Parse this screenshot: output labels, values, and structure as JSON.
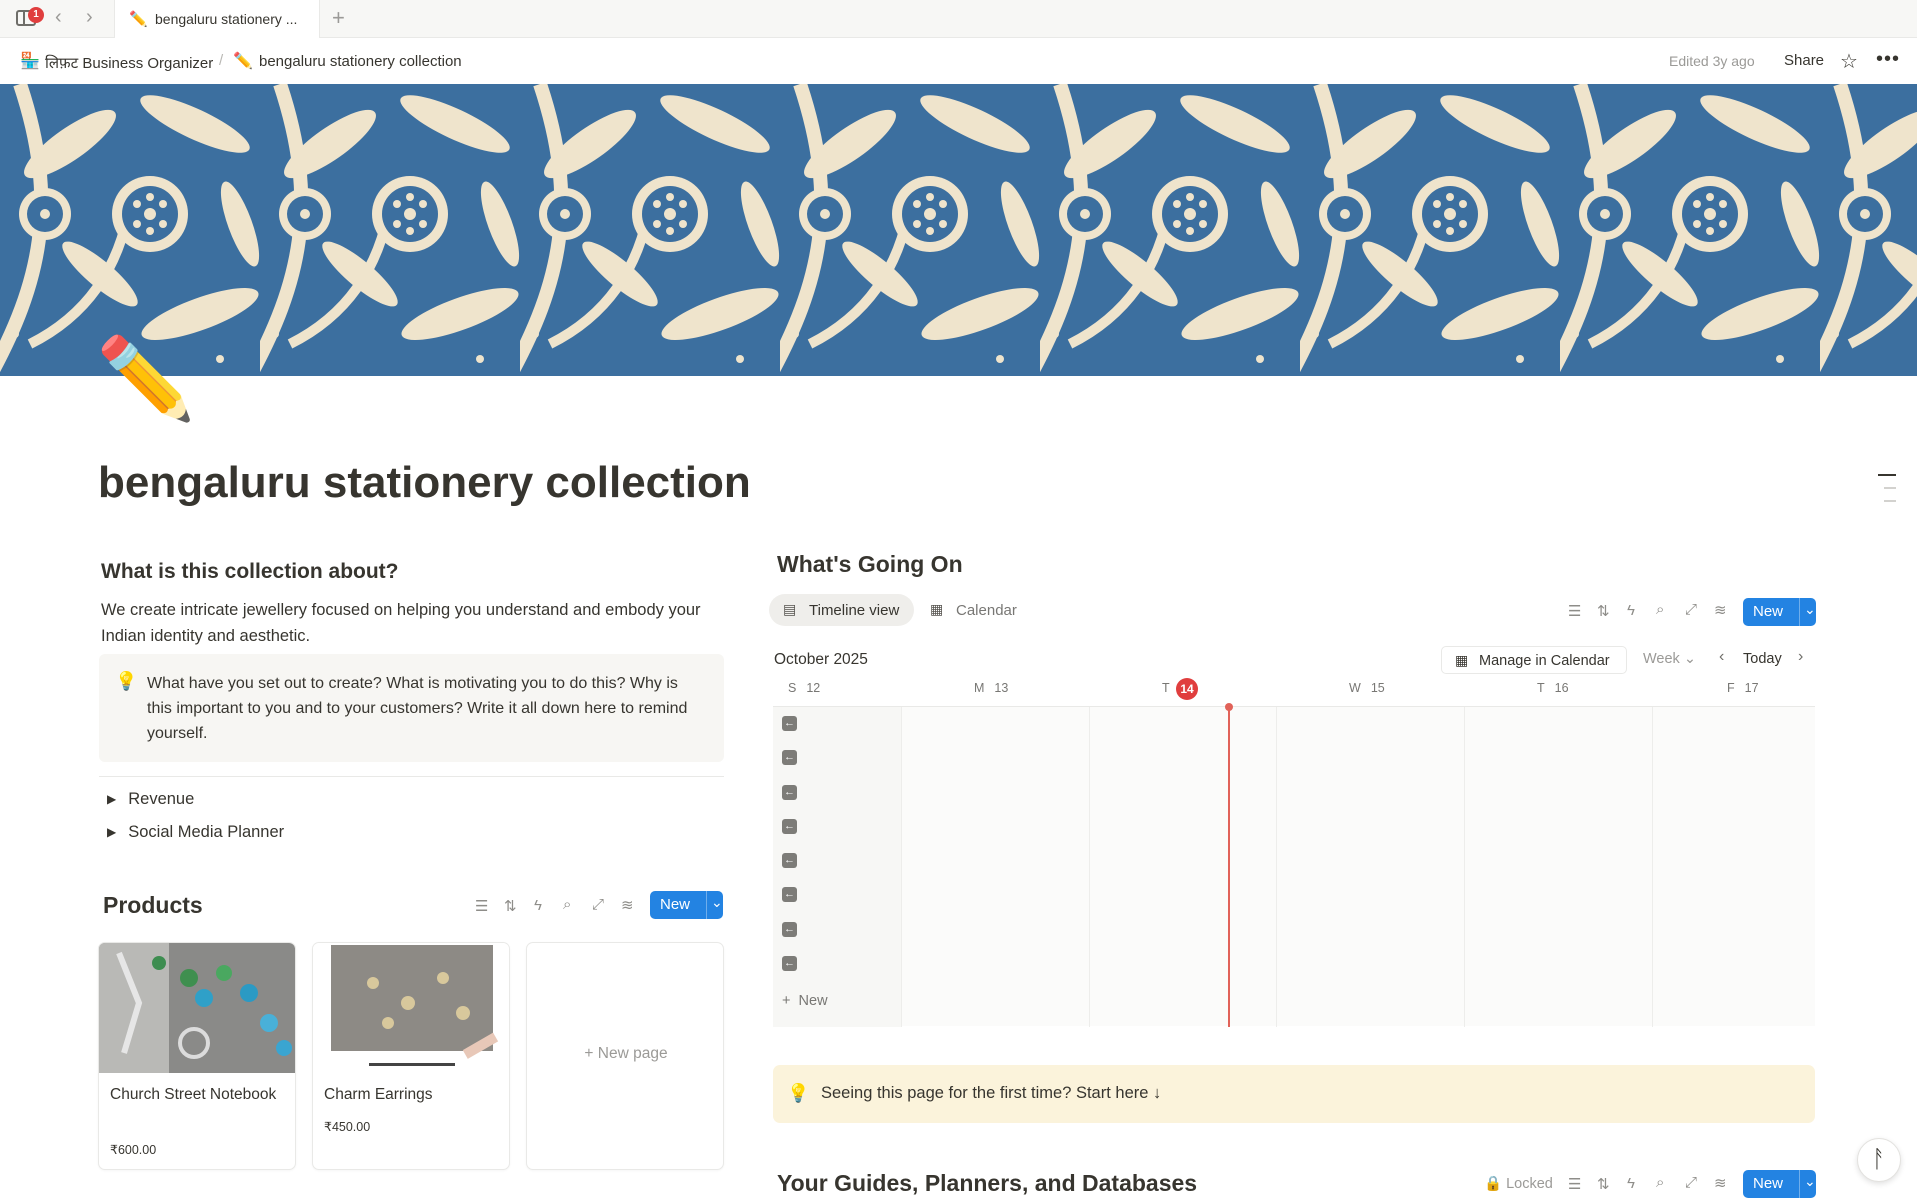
{
  "tabbar": {
    "badge": "1",
    "back_icon": "chevron-left-icon",
    "forward_icon": "chevron-right-icon",
    "tab_title": "bengaluru stationery ...",
    "tab_emoji": "✏️",
    "new_tab_icon": "plus-icon"
  },
  "topbar": {
    "crumb1_emoji": "🏪",
    "crumb1": "लिफ़ट Business Organizer",
    "crumb_sep": "/",
    "crumb2_emoji": "✏️",
    "crumb2": "bengaluru stationery collection",
    "edited": "Edited 3y ago",
    "share": "Share",
    "star_icon": "star-icon",
    "more_icon": "more-icon"
  },
  "page": {
    "icon": "✏️",
    "title": "bengaluru stationery collection"
  },
  "about": {
    "heading": "What is this collection about?",
    "paragraph": "We create intricate jewellery focused on helping you understand and embody your Indian identity and aesthetic.",
    "callout_icon": "💡",
    "callout": "What have you set out to create? What is motivating you to do this? Why is this important to you and to your customers? Write it all down here to remind yourself."
  },
  "toggles": [
    {
      "label": "Revenue"
    },
    {
      "label": "Social Media Planner"
    }
  ],
  "products": {
    "heading": "Products",
    "new_label": "New",
    "cards": [
      {
        "title": "Church Street Notebook",
        "price": "₹600.00"
      },
      {
        "title": "Charm Earrings",
        "price": "₹450.00"
      }
    ],
    "new_page_label": "New page"
  },
  "going_on": {
    "heading": "What's Going On",
    "tabs": [
      {
        "label": "Timeline view",
        "active": true
      },
      {
        "label": "Calendar",
        "active": false
      }
    ],
    "new_label": "New",
    "month": "October 2025",
    "manage_label": "Manage in Calendar",
    "week_label": "Week",
    "today_label": "Today",
    "days": [
      {
        "letter": "S",
        "num": "12"
      },
      {
        "letter": "M",
        "num": "13"
      },
      {
        "letter": "T",
        "num": "14"
      },
      {
        "letter": "W",
        "num": "15"
      },
      {
        "letter": "T",
        "num": "16"
      },
      {
        "letter": "F",
        "num": "17"
      }
    ],
    "today_num": "14",
    "row_count": 8,
    "grid_new": "New"
  },
  "first_time": {
    "icon": "💡",
    "text": "Seeing this page for the first time? Start here ↓"
  },
  "guides": {
    "heading": "Your Guides, Planners, and Databases",
    "locked": "Locked",
    "new_label": "New"
  },
  "colors": {
    "accent": "#2383e2",
    "today": "#e03e3e",
    "callout_yellow": "#fbf3db"
  }
}
